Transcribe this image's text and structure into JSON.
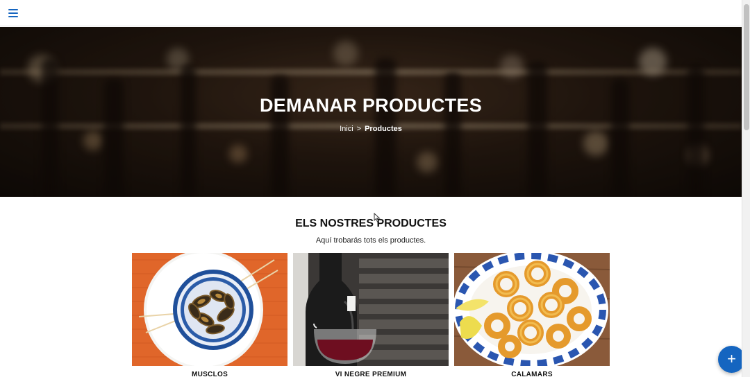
{
  "header": {
    "menu_icon": "menu-icon"
  },
  "hero": {
    "title": "DEMANAR PRODUCTES",
    "breadcrumb": {
      "home": "Inici",
      "separator": ">",
      "current": "Productes"
    }
  },
  "section": {
    "title": "ELS NOSTRES PRODUCTES",
    "subtitle": "Aquí trobarás tots els productes."
  },
  "products": [
    {
      "name": "MUSCLOS"
    },
    {
      "name": "VI NEGRE PREMIUM"
    },
    {
      "name": "CALAMARS"
    }
  ],
  "fab": {
    "label": "+"
  },
  "colors": {
    "accent": "#1565c0",
    "hero_bg": "#2a1c12"
  }
}
